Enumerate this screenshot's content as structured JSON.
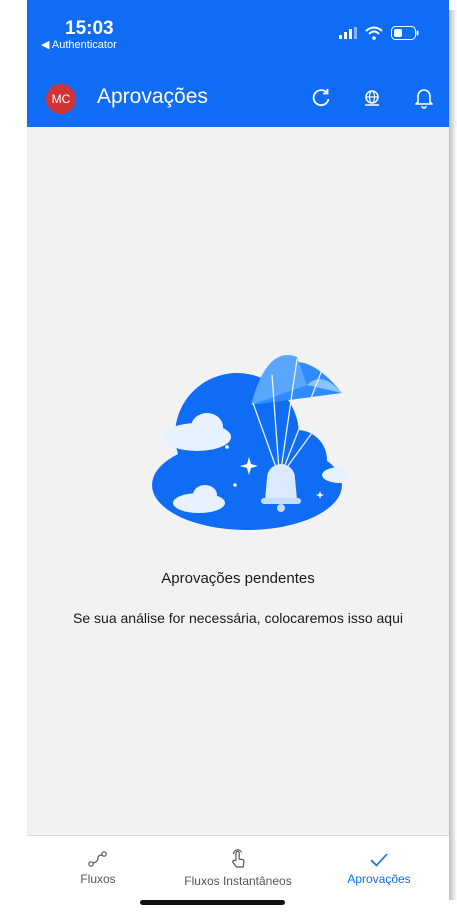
{
  "status_bar": {
    "time": "15:03",
    "back_app": "◀ Authenticator"
  },
  "header": {
    "avatar_initials": "MC",
    "title": "Aprovações"
  },
  "empty_state": {
    "title": "Aprovações pendentes",
    "subtitle": "Se sua análise for necessária, colocaremos isso aqui"
  },
  "tabs": [
    {
      "label": "Fluxos",
      "icon": "flow-icon"
    },
    {
      "label": "Fluxos Instantâneos",
      "icon": "touch-icon"
    },
    {
      "label": "Aprovações",
      "icon": "check-icon",
      "active": true
    }
  ],
  "colors": {
    "accent": "#0f6cf5",
    "avatar": "#d13438",
    "background": "#f2f2f2"
  }
}
